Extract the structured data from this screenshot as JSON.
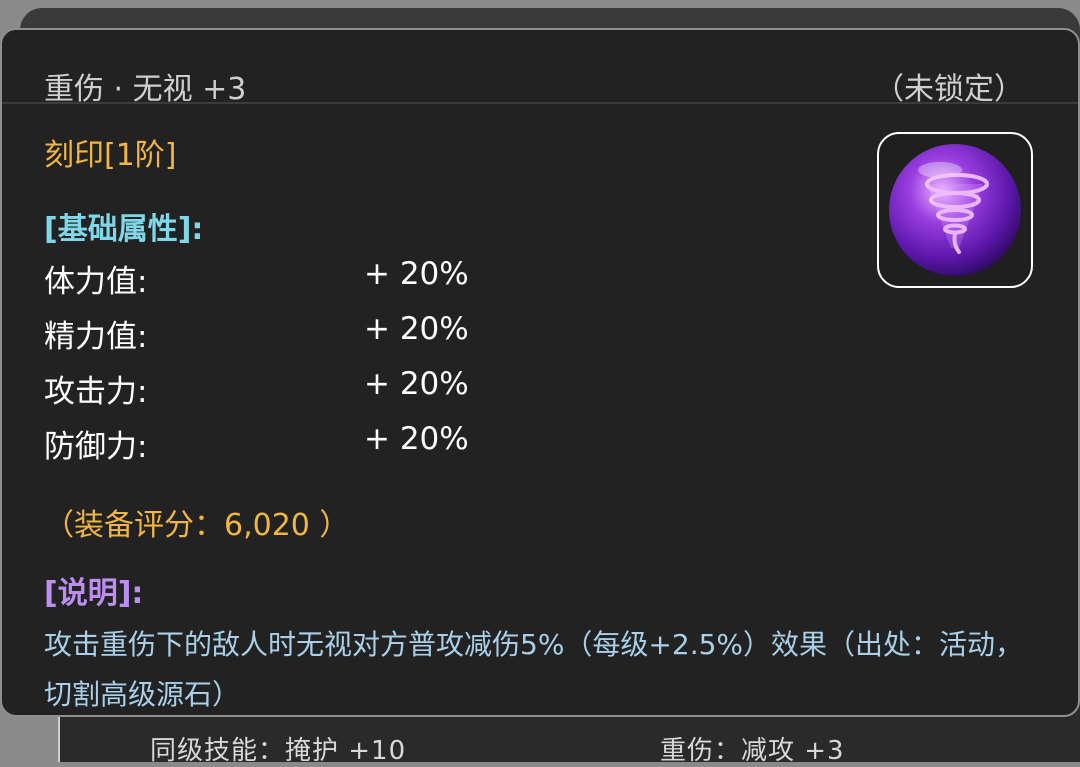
{
  "background": {
    "bottom_left_text": "同级技能：掩护 +10",
    "bottom_right_text": "重伤：减攻 +3"
  },
  "item": {
    "name": "重伤 · 无视  +3",
    "lock_status": "（未锁定）",
    "tier": "刻印[1阶]",
    "icon": "purple-tornado-orb-icon",
    "base_attributes_title": "[基础属性]:",
    "attributes": [
      {
        "label": "体力值:",
        "value": "+ 20%"
      },
      {
        "label": "精力值:",
        "value": "+ 20%"
      },
      {
        "label": "攻击力:",
        "value": "+ 20%"
      },
      {
        "label": "防御力:",
        "value": "+ 20%"
      }
    ],
    "score": "（装备评分：6,020 ）",
    "description_title": "[说明]:",
    "description": "攻击重伤下的敌人时无视对方普攻减伤5%（每级+2.5%）效果（出处：活动，切割高级源石）"
  },
  "colors": {
    "gold": "#f0b542",
    "cyan": "#7fd7e8",
    "purple": "#bb8ef0",
    "desc_blue": "#a9d0e8"
  }
}
